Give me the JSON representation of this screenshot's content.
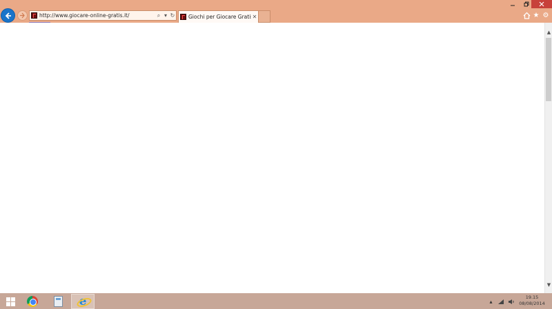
{
  "browser": {
    "address_url": "http://www.giocare-online-gratis.it/",
    "tab_title": "Giochi per Giocare Gratis O...",
    "icons": {
      "back": "back-arrow-icon",
      "forward": "forward-arrow-icon",
      "search": "search-icon",
      "dropdown": "dropdown-icon",
      "refresh": "refresh-icon",
      "tab_close": "close-icon",
      "home": "home-icon",
      "favorites": "star-icon",
      "tools": "gear-icon"
    },
    "colors": {
      "chrome_bg": "#eaa987",
      "back_button": "#1a74c9",
      "close_button": "#c7413a"
    }
  },
  "taskbar": {
    "time": "19.15",
    "date": "08/08/2014",
    "apps": [
      "start",
      "chrome",
      "calculator",
      "internet-explorer"
    ],
    "colors": {
      "bg": "#c7a798"
    }
  }
}
